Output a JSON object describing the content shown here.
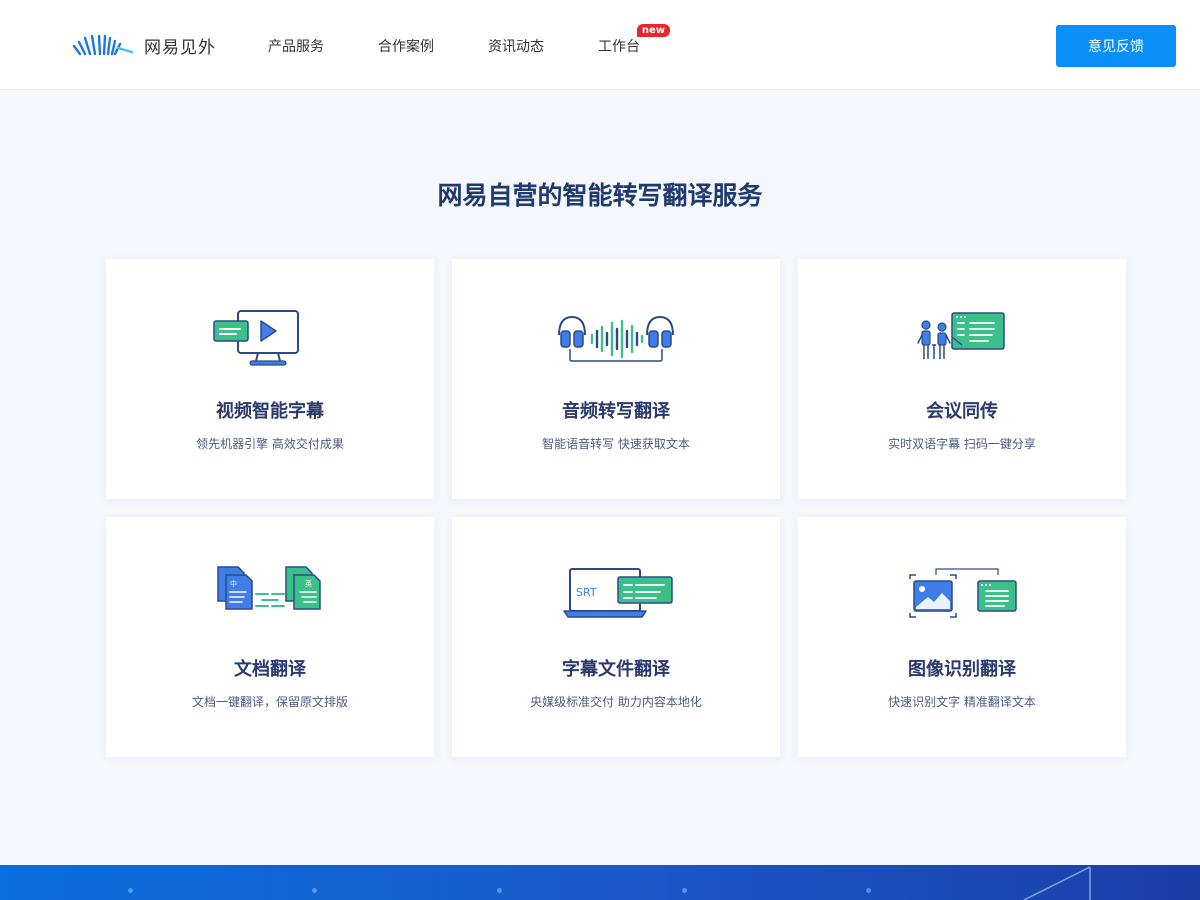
{
  "header": {
    "logo_text": "网易见外",
    "nav": [
      {
        "label": "产品服务"
      },
      {
        "label": "合作案例"
      },
      {
        "label": "资讯动态"
      },
      {
        "label": "工作台",
        "badge": "new"
      }
    ],
    "feedback_label": "意见反馈"
  },
  "main": {
    "title": "网易自营的智能转写翻译服务",
    "cards": [
      {
        "title": "视频智能字幕",
        "desc": "领先机器引擎 高效交付成果",
        "icon": "video-subtitle-icon"
      },
      {
        "title": "音频转写翻译",
        "desc": "智能语音转写 快速获取文本",
        "icon": "audio-headphones-icon"
      },
      {
        "title": "会议同传",
        "desc": "实时双语字幕 扫码一键分享",
        "icon": "meeting-icon"
      },
      {
        "title": "文档翻译",
        "desc": "文档一键翻译，保留原文排版",
        "icon": "document-translate-icon"
      },
      {
        "title": "字幕文件翻译",
        "desc": "央媒级标准交付 助力内容本地化",
        "icon": "srt-file-icon",
        "icon_text": "SRT"
      },
      {
        "title": "图像识别翻译",
        "desc": "快速识别文字 精准翻译文本",
        "icon": "image-recognition-icon"
      }
    ],
    "doc_icon_labels": {
      "source": "中",
      "target": "英"
    }
  },
  "colors": {
    "accent": "#0a8ef8",
    "icon_blue": "#3f7ee8",
    "icon_green": "#3cc08a",
    "title": "#1f3a6e",
    "badge": "#e8242c"
  }
}
